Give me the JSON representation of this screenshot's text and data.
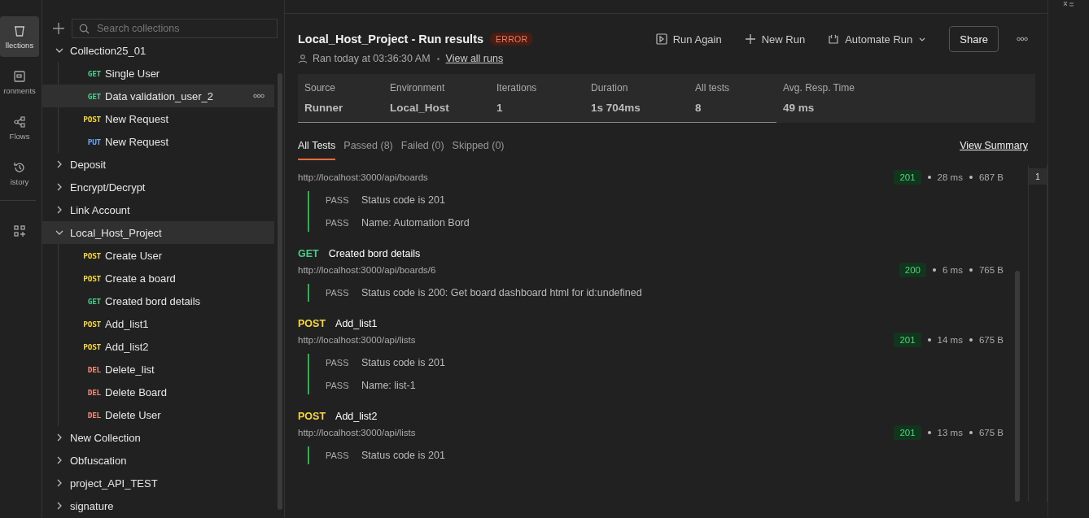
{
  "rail": [
    {
      "label": "llections",
      "selected": true
    },
    {
      "label": "ronments",
      "selected": false
    },
    {
      "label": "Flows",
      "selected": false
    },
    {
      "label": "istory",
      "selected": false
    },
    {
      "selected": false
    }
  ],
  "sidebar": {
    "search": {
      "placeholder": "Search collections"
    },
    "items": [
      {
        "name": "Collection25_01",
        "expanded": true,
        "selected": false,
        "children": [
          {
            "method": "GET",
            "name": "Single User",
            "selected": false
          },
          {
            "method": "GET",
            "name": "Data validation_user_2",
            "selected": true
          },
          {
            "method": "POST",
            "name": "New Request",
            "selected": false
          },
          {
            "method": "PUT",
            "name": "New Request",
            "selected": false
          }
        ]
      },
      {
        "name": "Deposit",
        "expanded": false,
        "selected": false
      },
      {
        "name": "Encrypt/Decrypt",
        "expanded": false,
        "selected": false
      },
      {
        "name": "Link Account",
        "expanded": false,
        "selected": false
      },
      {
        "name": "Local_Host_Project",
        "expanded": true,
        "selected": true,
        "children": [
          {
            "method": "POST",
            "name": "Create User",
            "selected": false
          },
          {
            "method": "POST",
            "name": "Create a board",
            "selected": false
          },
          {
            "method": "GET",
            "name": "Created bord details",
            "selected": false
          },
          {
            "method": "POST",
            "name": "Add_list1",
            "selected": false
          },
          {
            "method": "POST",
            "name": "Add_list2",
            "selected": false
          },
          {
            "method": "DEL",
            "name": "Delete_list",
            "selected": false
          },
          {
            "method": "DEL",
            "name": "Delete Board",
            "selected": false
          },
          {
            "method": "DEL",
            "name": "Delete User",
            "selected": false
          }
        ]
      },
      {
        "name": "New Collection",
        "expanded": false,
        "selected": false
      },
      {
        "name": "Obfuscation",
        "expanded": false,
        "selected": false
      },
      {
        "name": "project_API_TEST",
        "expanded": false,
        "selected": false
      },
      {
        "name": "signature",
        "expanded": false,
        "selected": false
      }
    ]
  },
  "run": {
    "title": "Local_Host_Project - Run results",
    "status": "ERROR",
    "actions": [
      {
        "label": "Run Again"
      },
      {
        "label": "New Run"
      },
      {
        "label": "Automate Run"
      }
    ],
    "share": "Share",
    "ran": "Ran today at 03:36:30 AM",
    "view_all": "View all runs",
    "stats": [
      {
        "label": "Source",
        "value": "Runner"
      },
      {
        "label": "Environment",
        "value": "Local_Host"
      },
      {
        "label": "Iterations",
        "value": "1"
      },
      {
        "label": "Duration",
        "value": "1s 704ms"
      },
      {
        "label": "All tests",
        "value": "8"
      },
      {
        "label": "Avg. Resp. Time",
        "value": "49 ms"
      }
    ],
    "tabs": [
      {
        "label": "All Tests",
        "selected": true
      },
      {
        "label": "Passed (8)",
        "selected": false
      },
      {
        "label": "Failed (0)",
        "selected": false
      },
      {
        "label": "Skipped (0)",
        "selected": false
      }
    ],
    "view_summary": "View Summary",
    "results": [
      {
        "url": "http://localhost:3000/api/boards",
        "code": "201",
        "time": "28 ms",
        "size": "687 B",
        "tests": [
          {
            "result": "PASS",
            "name": "Status code is 201"
          },
          {
            "result": "PASS",
            "name": "Name: Automation Bord"
          }
        ]
      },
      {
        "method": "GET",
        "name": "Created bord details",
        "url": "http://localhost:3000/api/boards/6",
        "code": "200",
        "time": "6 ms",
        "size": "765 B",
        "tests": [
          {
            "result": "PASS",
            "name": "Status code is 200: Get board dashboard html for id:undefined"
          }
        ]
      },
      {
        "method": "POST",
        "name": "Add_list1",
        "url": "http://localhost:3000/api/lists",
        "code": "201",
        "time": "14 ms",
        "size": "675 B",
        "tests": [
          {
            "result": "PASS",
            "name": "Status code is 201"
          },
          {
            "result": "PASS",
            "name": "Name: list-1"
          }
        ]
      },
      {
        "method": "POST",
        "name": "Add_list2",
        "url": "http://localhost:3000/api/lists",
        "code": "201",
        "time": "13 ms",
        "size": "675 B",
        "tests": [
          {
            "result": "PASS",
            "name": "Status code is 201"
          }
        ]
      }
    ],
    "iteration": "1"
  }
}
